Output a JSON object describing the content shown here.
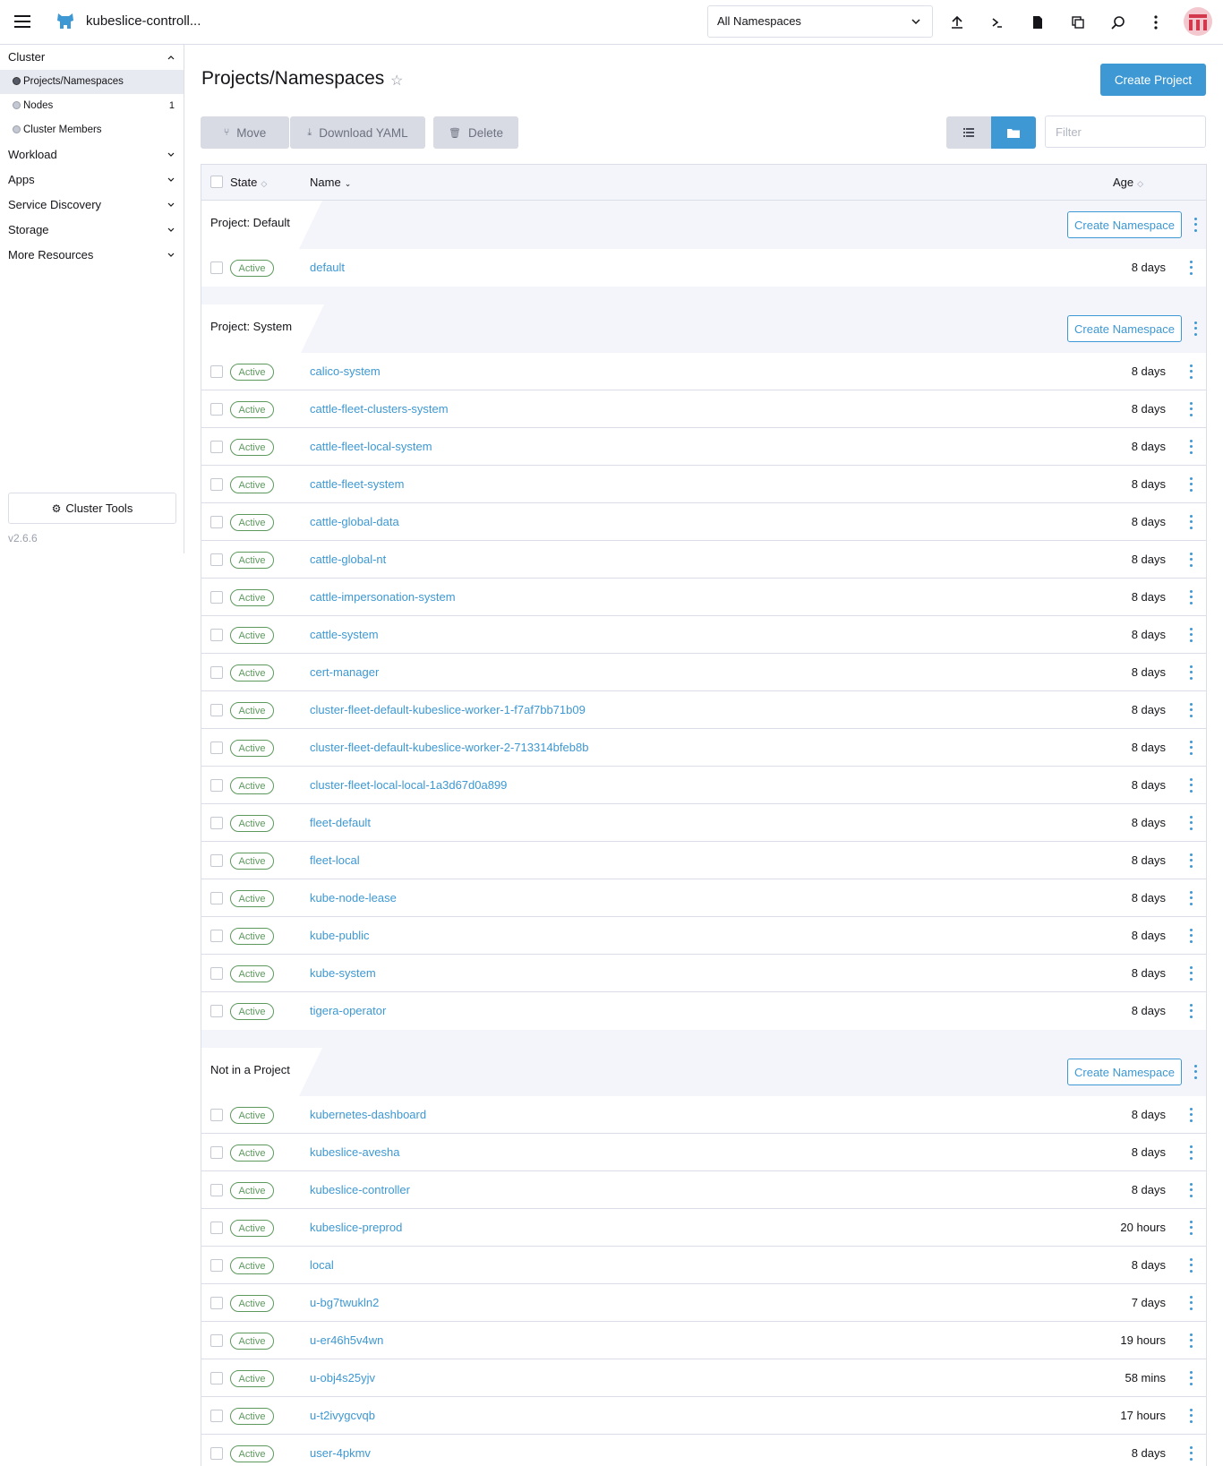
{
  "header": {
    "cluster_name": "kubeslice-controll...",
    "namespace_select": "All Namespaces",
    "icons": [
      "upload-icon",
      "terminal-icon",
      "file-icon",
      "copy-icon",
      "search-icon",
      "more-vertical-icon"
    ]
  },
  "sidebar": {
    "groups": {
      "cluster": "Cluster",
      "workload": "Workload",
      "apps": "Apps",
      "service_discovery": "Service Discovery",
      "storage": "Storage",
      "more_resources": "More Resources"
    },
    "items": {
      "projects": "Projects/Namespaces",
      "nodes": "Nodes",
      "nodes_count": "1",
      "members": "Cluster Members"
    },
    "cluster_tools": "Cluster Tools",
    "version": "v2.6.6"
  },
  "main": {
    "title": "Projects/Namespaces",
    "create_project": "Create Project",
    "actions": {
      "move": "Move",
      "download": "Download YAML",
      "delete": "Delete"
    },
    "filter_placeholder": "Filter"
  },
  "table": {
    "headers": {
      "state": "State",
      "name": "Name",
      "age": "Age"
    },
    "create_namespace": "Create Namespace",
    "status_label": "Active",
    "groups": [
      {
        "label": "Project: Default",
        "rows": [
          {
            "name": "default",
            "age": "8 days"
          }
        ]
      },
      {
        "label": "Project: System",
        "rows": [
          {
            "name": "calico-system",
            "age": "8 days"
          },
          {
            "name": "cattle-fleet-clusters-system",
            "age": "8 days"
          },
          {
            "name": "cattle-fleet-local-system",
            "age": "8 days"
          },
          {
            "name": "cattle-fleet-system",
            "age": "8 days"
          },
          {
            "name": "cattle-global-data",
            "age": "8 days"
          },
          {
            "name": "cattle-global-nt",
            "age": "8 days"
          },
          {
            "name": "cattle-impersonation-system",
            "age": "8 days"
          },
          {
            "name": "cattle-system",
            "age": "8 days"
          },
          {
            "name": "cert-manager",
            "age": "8 days"
          },
          {
            "name": "cluster-fleet-default-kubeslice-worker-1-f7af7bb71b09",
            "age": "8 days"
          },
          {
            "name": "cluster-fleet-default-kubeslice-worker-2-713314bfeb8b",
            "age": "8 days"
          },
          {
            "name": "cluster-fleet-local-local-1a3d67d0a899",
            "age": "8 days"
          },
          {
            "name": "fleet-default",
            "age": "8 days"
          },
          {
            "name": "fleet-local",
            "age": "8 days"
          },
          {
            "name": "kube-node-lease",
            "age": "8 days"
          },
          {
            "name": "kube-public",
            "age": "8 days"
          },
          {
            "name": "kube-system",
            "age": "8 days"
          },
          {
            "name": "tigera-operator",
            "age": "8 days"
          }
        ]
      },
      {
        "label": "Not in a Project",
        "rows": [
          {
            "name": "kubernetes-dashboard",
            "age": "8 days"
          },
          {
            "name": "kubeslice-avesha",
            "age": "8 days"
          },
          {
            "name": "kubeslice-controller",
            "age": "8 days"
          },
          {
            "name": "kubeslice-preprod",
            "age": "20 hours"
          },
          {
            "name": "local",
            "age": "8 days"
          },
          {
            "name": "u-bg7twukln2",
            "age": "7 days"
          },
          {
            "name": "u-er46h5v4wn",
            "age": "19 hours"
          },
          {
            "name": "u-obj4s25yjv",
            "age": "58 mins"
          },
          {
            "name": "u-t2ivygcvqb",
            "age": "17 hours"
          },
          {
            "name": "user-4pkmv",
            "age": "8 days"
          }
        ]
      }
    ]
  },
  "colors": {
    "accent": "#3d98d3",
    "active_status": "#5d995d",
    "border": "#dcdee7",
    "muted_bg": "#f4f5fa"
  }
}
